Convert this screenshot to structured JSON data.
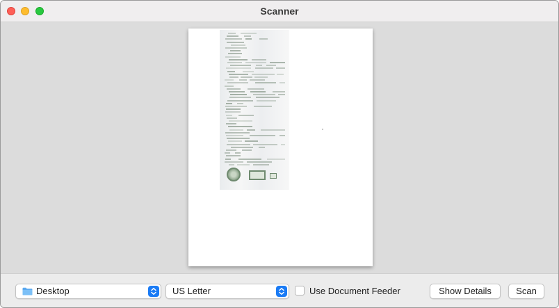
{
  "window": {
    "title": "Scanner"
  },
  "toolbar": {
    "destination": {
      "value": "Desktop",
      "icon": "folder-icon"
    },
    "paper_size": {
      "value": "US Letter"
    },
    "document_feeder": {
      "label": "Use Document Feeder",
      "checked": false
    },
    "show_details_label": "Show Details",
    "scan_label": "Scan"
  },
  "colors": {
    "close": "#fe5f57",
    "minimize": "#febc2e",
    "zoom": "#28c840",
    "accent": "#1a7bf5"
  }
}
